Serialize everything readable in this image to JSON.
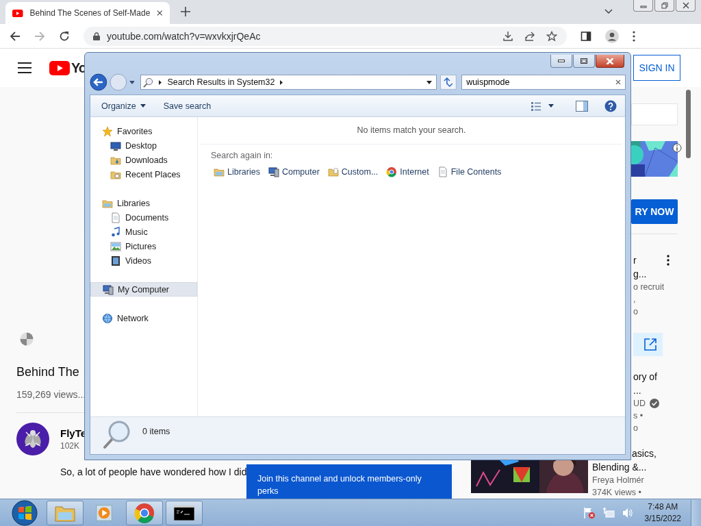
{
  "browser": {
    "tab": {
      "title": "Behind The Scenes of Self-Made"
    },
    "address": "youtube.com/watch?v=wxvkxjrQeAc",
    "forward": {
      "disabled": true
    }
  },
  "youtube": {
    "logo_text": "Yo",
    "sign_in": "SIGN IN",
    "title": "Behind The",
    "views": "159,269 views...",
    "channel": {
      "name": "FlyTe",
      "subscribers": "102K"
    },
    "description": "So, a lot of people have wondered how I did",
    "members_tooltip": "Join this channel and unlock members-only perks",
    "sidebar": {
      "ad_action": "RY NOW",
      "items": [
        {
          "title_lines": [
            "r",
            "g..."
          ],
          "meta_lines": [
            "o recruit",
            ",",
            "o"
          ],
          "verified": false,
          "menu": true
        },
        {
          "title_lines": [
            "ory of",
            "..."
          ],
          "meta_lines": [
            "UD",
            "s •",
            "o"
          ],
          "verified": true,
          "menu": false
        },
        {
          "title_lines": [
            "asics,",
            "Blending &..."
          ],
          "meta_lines": [
            "Freya Holmér",
            "374K views •"
          ],
          "verified": false,
          "menu": false,
          "thumbnail": {
            "kind": "picture"
          }
        }
      ]
    }
  },
  "explorer": {
    "address": "Search Results in System32",
    "search": "wuispmode",
    "toolbar": [
      {
        "label": "Organize",
        "dropdown": true
      },
      {
        "label": "Save search",
        "dropdown": false
      }
    ],
    "nav": [
      {
        "label": "Favorites",
        "kind": "star",
        "selected": false,
        "children": [
          {
            "label": "Desktop",
            "kind": "desktop",
            "selected": false
          },
          {
            "label": "Downloads",
            "kind": "downloads",
            "selected": false
          },
          {
            "label": "Recent Places",
            "kind": "recent",
            "selected": false
          }
        ]
      },
      {
        "label": "Libraries",
        "kind": "library",
        "selected": false,
        "children": [
          {
            "label": "Documents",
            "kind": "document",
            "selected": false
          },
          {
            "label": "Music",
            "kind": "music",
            "selected": false
          },
          {
            "label": "Pictures",
            "kind": "pictures",
            "selected": false
          },
          {
            "label": "Videos",
            "kind": "video",
            "selected": false
          }
        ]
      },
      {
        "label": "My Computer",
        "kind": "computer",
        "selected": true
      },
      {
        "label": "Network",
        "kind": "network",
        "selected": false
      }
    ],
    "message": "No items match your search.",
    "search_again": {
      "label": "Search again in:",
      "items": [
        {
          "label": "Libraries",
          "kind": "library"
        },
        {
          "label": "Computer",
          "kind": "computer"
        },
        {
          "label": "Custom...",
          "kind": "custom"
        },
        {
          "label": "Internet",
          "kind": "internet"
        },
        {
          "label": "File Contents",
          "kind": "document"
        }
      ]
    },
    "status": "0 items"
  },
  "taskbar": {
    "items": [
      {
        "kind": "folder",
        "running": true
      },
      {
        "kind": "media",
        "running": false
      },
      {
        "kind": "chrome",
        "running": true
      },
      {
        "kind": "console",
        "running": true
      }
    ],
    "time": "7:48 AM",
    "date": "3/15/2022"
  }
}
